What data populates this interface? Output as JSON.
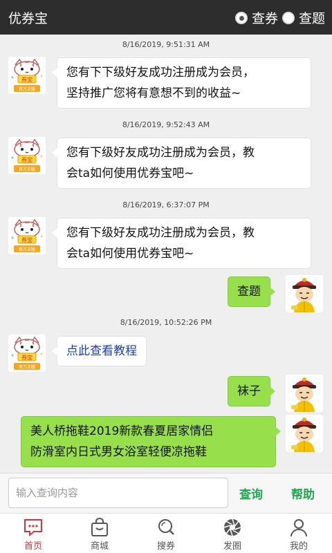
{
  "header": {
    "title": "优券宝",
    "options": [
      {
        "label": "查券",
        "selected": true
      },
      {
        "label": "查题",
        "selected": false
      }
    ]
  },
  "messages": [
    {
      "timestamp": "8/16/2019, 9:51:31 AM",
      "side": "left",
      "lines": [
        "您有下下级好友成功注册成为会员，",
        "坚持推广您将有意想不到的收益~"
      ]
    },
    {
      "timestamp": "8/16/2019, 9:52:43 AM",
      "side": "left",
      "lines": [
        "您有下级好友成功注册成为会员，教",
        "会ta如何使用优券宝吧~"
      ]
    },
    {
      "timestamp": "8/16/2019, 6:37:07 PM",
      "side": "left",
      "lines": [
        "您有下级好友成功注册成为会员，教",
        "会ta如何使用优券宝吧~"
      ]
    },
    {
      "side": "right",
      "lines": [
        "查题"
      ]
    },
    {
      "timestamp": "8/16/2019, 10:52:26 PM",
      "side": "left",
      "link": "点此查看教程"
    },
    {
      "side": "right",
      "lines": [
        "袜子"
      ]
    },
    {
      "side": "right",
      "lines": [
        "美人桥拖鞋2019新款春夏居家情侣",
        "防滑室内日式男女浴室轻便凉拖鞋"
      ]
    }
  ],
  "avatar_text": {
    "bot_badge": "券宝",
    "bot_caption": "官方正版"
  },
  "input": {
    "placeholder": "输入查询内容",
    "value": ""
  },
  "buttons": {
    "search": "查询",
    "help": "帮助"
  },
  "tabs": [
    {
      "label": "首页",
      "icon": "message-icon",
      "active": true
    },
    {
      "label": "商城",
      "icon": "shopping-bag-icon",
      "active": false
    },
    {
      "label": "搜券",
      "icon": "search-icon",
      "active": false
    },
    {
      "label": "发圈",
      "icon": "aperture-icon",
      "active": false
    },
    {
      "label": "我的",
      "icon": "user-icon",
      "active": false
    }
  ],
  "colors": {
    "accent_green": "#1ea84a",
    "bubble_green": "#97e04c",
    "active_tab": "#d8333a",
    "topbar": "#2d2d2d"
  }
}
